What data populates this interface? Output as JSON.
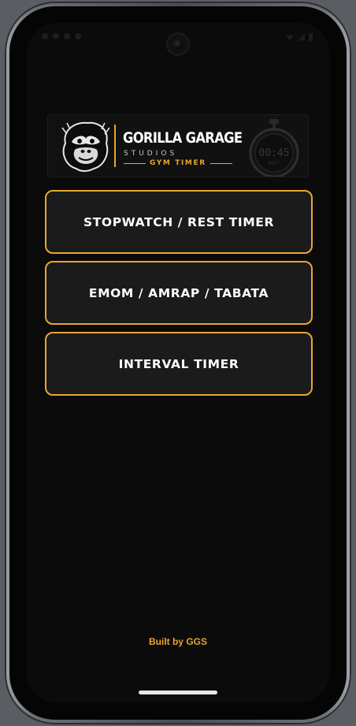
{
  "app": {
    "brand_title": "GORILLA GARAGE",
    "brand_subtitle": "STUDIOS",
    "brand_tag": "GYM TIMER",
    "stopwatch_display": "00:45",
    "stopwatch_caption": "REST"
  },
  "menu": {
    "items": [
      {
        "label": "STOPWATCH / REST TIMER"
      },
      {
        "label": "EMOM / AMRAP / TABATA"
      },
      {
        "label": "INTERVAL TIMER"
      }
    ]
  },
  "footer": {
    "credit": "Built by GGS"
  },
  "colors": {
    "accent": "#e8a631",
    "background": "#0b0b0b",
    "button_fill": "#1b1b1b",
    "text": "#ffffff"
  },
  "icons": [
    "gorilla-logo-icon",
    "stopwatch-icon",
    "camera-icon",
    "wifi-icon",
    "signal-icon",
    "battery-icon"
  ]
}
